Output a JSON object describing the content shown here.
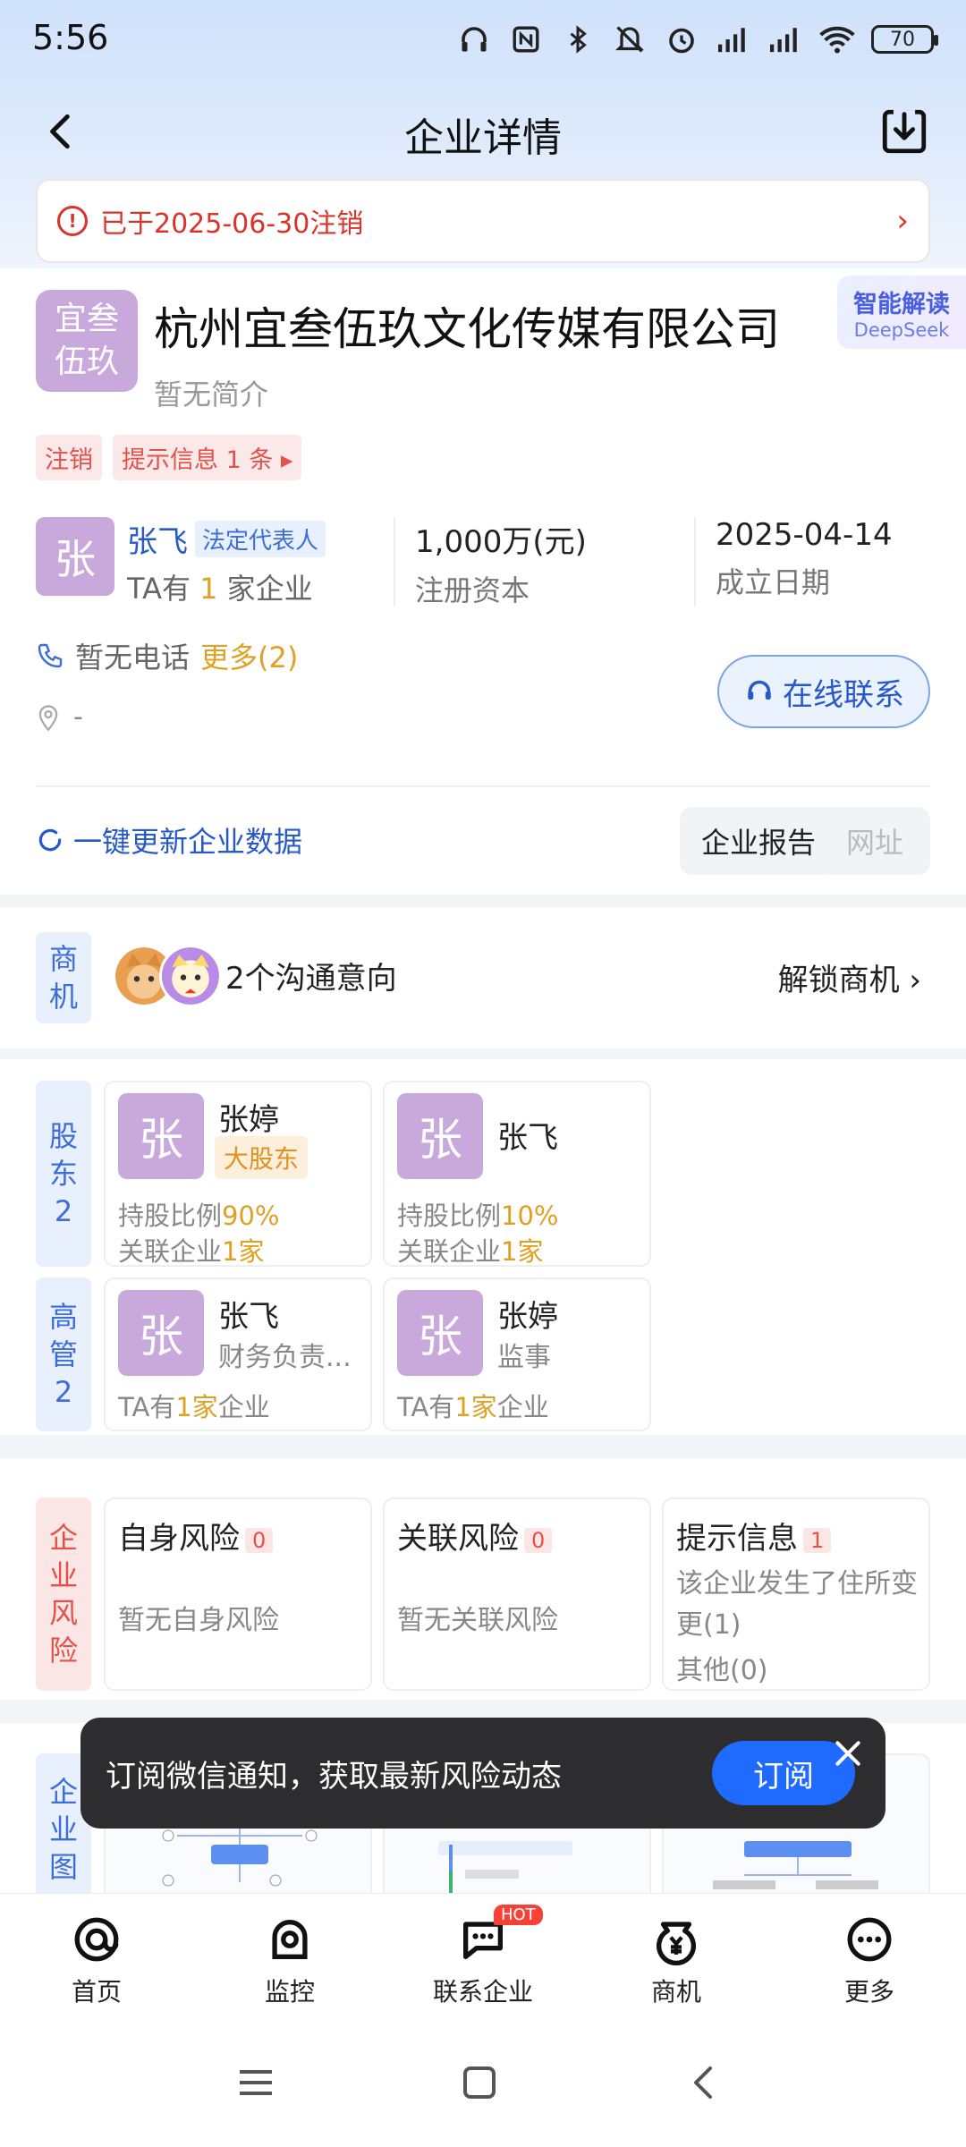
{
  "status_bar": {
    "time": "5:56",
    "battery": "70"
  },
  "nav": {
    "title": "企业详情"
  },
  "notice": {
    "text": "已于2025-06-30注销"
  },
  "company": {
    "logo_line1": "宜叁",
    "logo_line2": "伍玖",
    "name": "杭州宜叁伍玖文化传媒有限公司",
    "ai_label": "智能解读",
    "ai_sub": "DeepSeek",
    "desc": "暂无简介",
    "tags": [
      "注销",
      "提示信息 1 条"
    ]
  },
  "legal_rep": {
    "avatar": "张",
    "name": "张飞",
    "role": "法定代表人",
    "companies_prefix": "TA有",
    "companies_count": "1",
    "companies_suffix": "家企业"
  },
  "capital": {
    "value": "1,000万(元)",
    "label": "注册资本"
  },
  "founded": {
    "value": "2025-04-14",
    "label": "成立日期"
  },
  "phone": {
    "text": "暂无电话",
    "more": "更多(2)"
  },
  "address": {
    "text": "-"
  },
  "contact_button": "在线联系",
  "update_link": "一键更新企业数据",
  "report_button": "企业报告",
  "website_button": "网址",
  "opportunity": {
    "label": [
      "商",
      "机"
    ],
    "text": "2个沟通意向",
    "unlock": "解锁商机"
  },
  "shareholders": {
    "label": [
      "股",
      "东",
      "2"
    ],
    "items": [
      {
        "avatar": "张",
        "name": "张婷",
        "badge": "大股东",
        "ratio_label": "持股比例",
        "ratio": "90%",
        "rel_label": "关联企业",
        "rel": "1家"
      },
      {
        "avatar": "张",
        "name": "张飞",
        "ratio_label": "持股比例",
        "ratio": "10%",
        "rel_label": "关联企业",
        "rel": "1家"
      }
    ]
  },
  "executives": {
    "label": [
      "高",
      "管",
      "2"
    ],
    "items": [
      {
        "avatar": "张",
        "name": "张飞",
        "role": "财务负责...",
        "prefix": "TA有",
        "count": "1家",
        "suffix": "企业"
      },
      {
        "avatar": "张",
        "name": "张婷",
        "role": "监事",
        "prefix": "TA有",
        "count": "1家",
        "suffix": "企业"
      }
    ]
  },
  "risk": {
    "label": [
      "企",
      "业",
      "风",
      "险"
    ],
    "self": {
      "title": "自身风险",
      "count": "0",
      "text": "暂无自身风险"
    },
    "related": {
      "title": "关联风险",
      "count": "0",
      "text": "暂无关联风险"
    },
    "hint": {
      "title": "提示信息",
      "count": "1",
      "text": "该企业发生了住所变更(1)",
      "other": "其他(0)"
    }
  },
  "graph": {
    "label": [
      "企",
      "业",
      "图"
    ]
  },
  "toast": {
    "text": "订阅微信通知，获取最新风险动态",
    "button": "订阅"
  },
  "tabs": [
    {
      "label": "首页",
      "icon": "home-at-icon"
    },
    {
      "label": "监控",
      "icon": "monitor-icon"
    },
    {
      "label": "联系企业",
      "icon": "chat-icon",
      "badge": "HOT"
    },
    {
      "label": "商机",
      "icon": "yen-icon"
    },
    {
      "label": "更多",
      "icon": "more-icon"
    }
  ],
  "colors": {
    "accent": "#2759c9",
    "danger": "#d9342b",
    "avatar": "#c9a9dc",
    "highlight": "#e0a023"
  }
}
